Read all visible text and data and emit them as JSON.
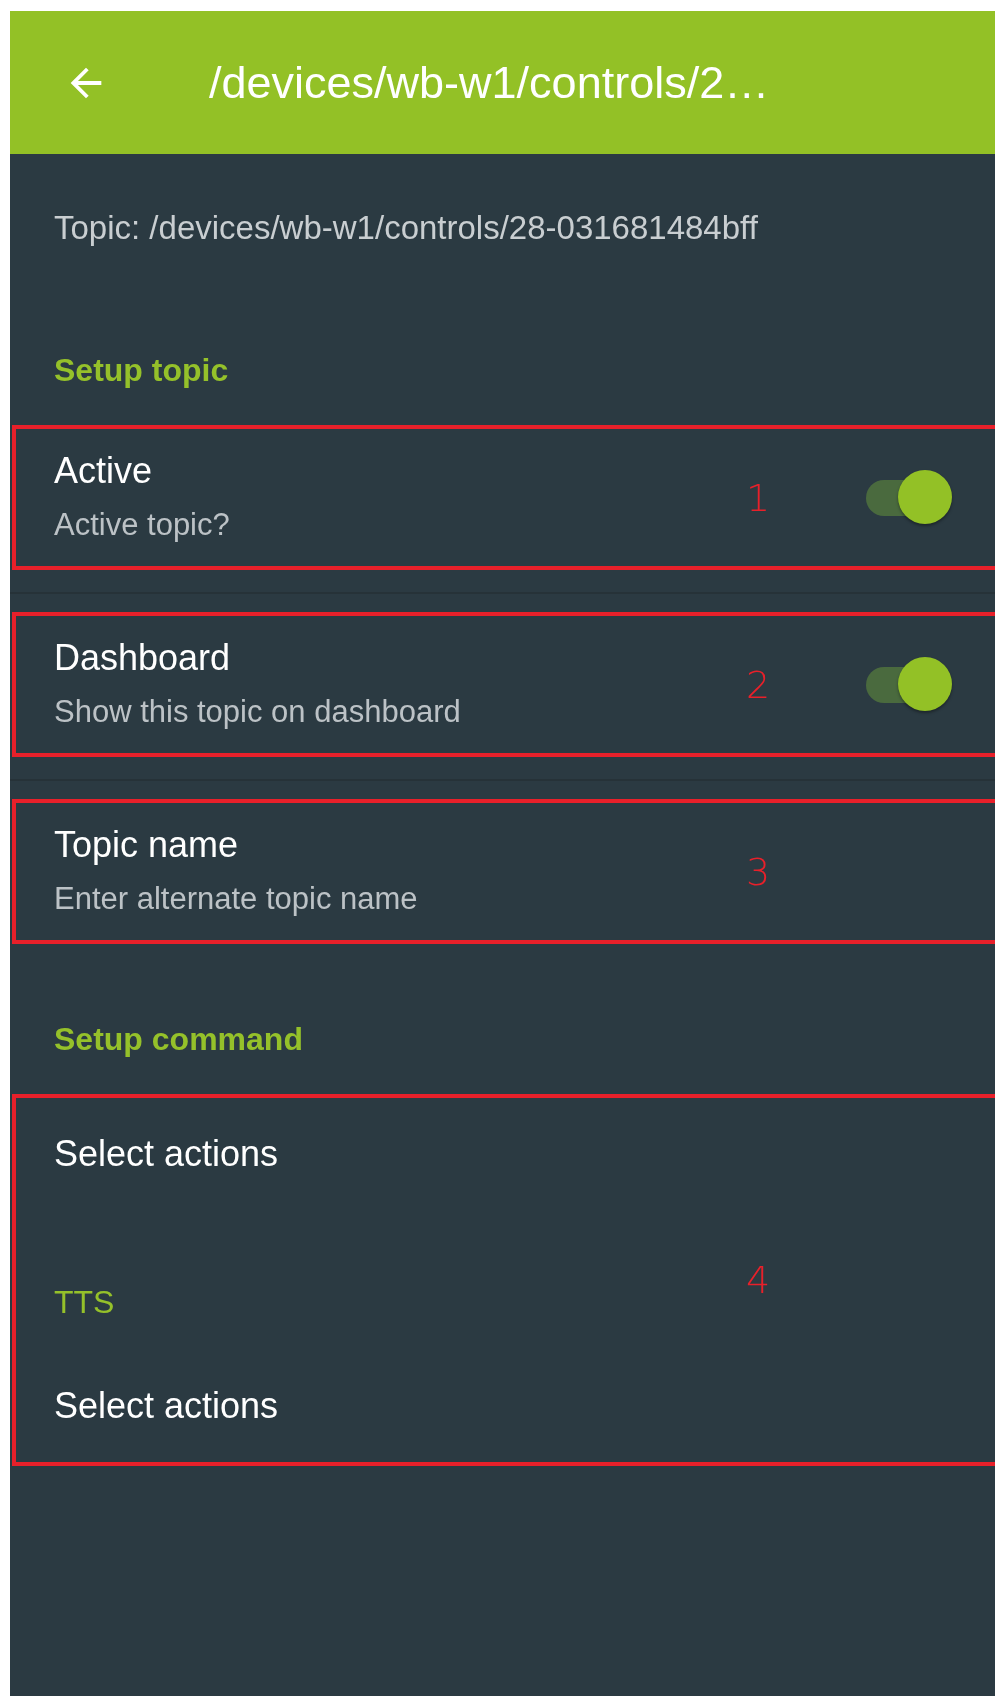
{
  "app_bar": {
    "title": "/devices/wb-w1/controls/2…"
  },
  "topic_line": "Topic: /devices/wb-w1/controls/28-031681484bff",
  "sections": [
    {
      "header": "Setup topic",
      "groups": [
        {
          "annotation": "1",
          "items": [
            {
              "kind": "switch",
              "title": "Active",
              "summary": "Active topic?",
              "on": true
            }
          ]
        },
        {
          "annotation": "2",
          "items": [
            {
              "kind": "switch",
              "title": "Dashboard",
              "summary": "Show this topic on dashboard",
              "on": true
            }
          ]
        },
        {
          "annotation": "3",
          "items": [
            {
              "kind": "text",
              "title": "Topic name",
              "summary": "Enter alternate topic name"
            }
          ]
        }
      ]
    },
    {
      "header": "Setup command",
      "groups": [
        {
          "annotation": "4",
          "items": [
            {
              "kind": "action",
              "title": "Select actions"
            },
            {
              "kind": "category",
              "title": "TTS"
            },
            {
              "kind": "action",
              "title": "Select actions"
            }
          ]
        }
      ]
    }
  ]
}
